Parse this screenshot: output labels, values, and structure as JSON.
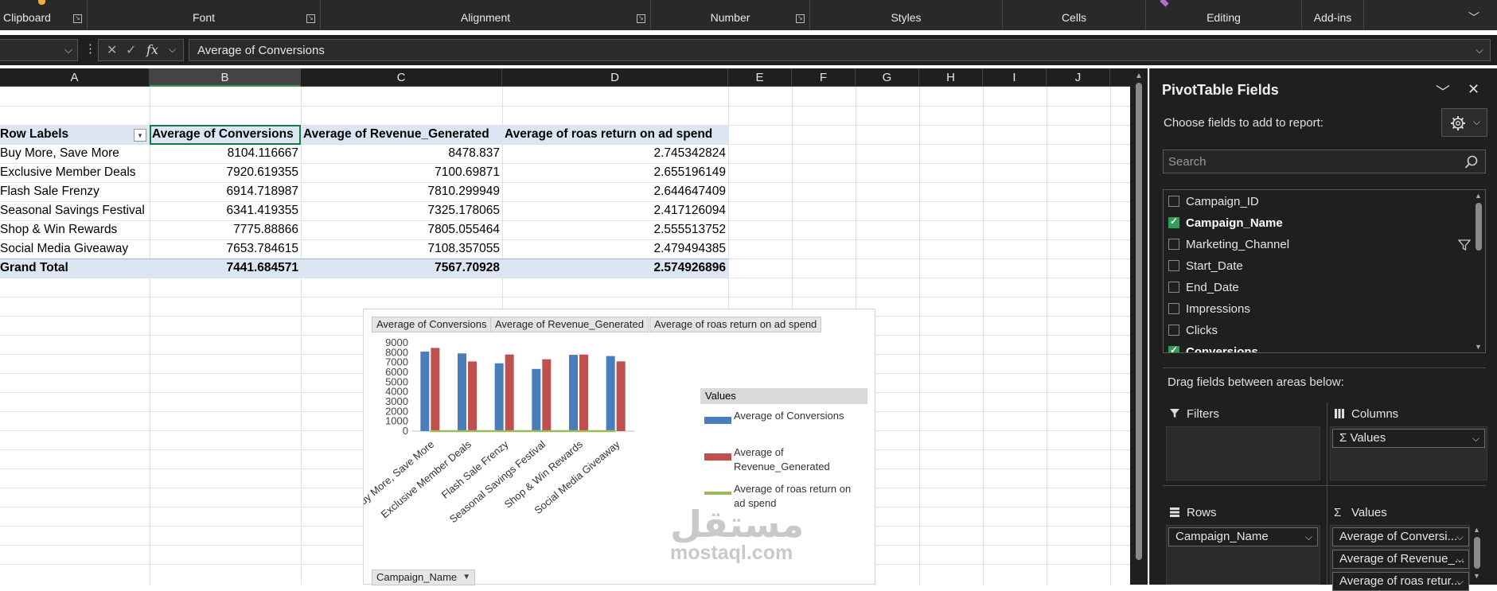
{
  "ribbon": {
    "groups": [
      {
        "name": "Clipboard"
      },
      {
        "name": "Font"
      },
      {
        "name": "Alignment"
      },
      {
        "name": "Number"
      },
      {
        "name": "Styles"
      },
      {
        "name": "Cells"
      },
      {
        "name": "Editing"
      },
      {
        "name": "Add-ins"
      }
    ]
  },
  "formula_bar": {
    "name_box": "",
    "cancel_icon": "✕",
    "enter_icon": "✓",
    "fx_label": "fx",
    "content": "Average of Conversions"
  },
  "columns": [
    "A",
    "B",
    "C",
    "D",
    "E",
    "F",
    "G",
    "H",
    "I",
    "J"
  ],
  "pivot": {
    "headers": [
      "Row Labels",
      "Average of Conversions",
      "Average of Revenue_Generated",
      "Average of roas return on ad spend"
    ],
    "rows": [
      {
        "label": "Buy More, Save More",
        "conv": "8104.116667",
        "rev": "8478.837",
        "roas": "2.745342824"
      },
      {
        "label": "Exclusive Member Deals",
        "conv": "7920.619355",
        "rev": "7100.69871",
        "roas": "2.655196149"
      },
      {
        "label": "Flash Sale Frenzy",
        "conv": "6914.718987",
        "rev": "7810.299949",
        "roas": "2.644647409"
      },
      {
        "label": "Seasonal Savings Festival",
        "conv": "6341.419355",
        "rev": "7325.178065",
        "roas": "2.417126094"
      },
      {
        "label": "Shop & Win Rewards",
        "conv": "7775.88866",
        "rev": "7805.055464",
        "roas": "2.555513752"
      },
      {
        "label": "Social Media Giveaway",
        "conv": "7653.784615",
        "rev": "7108.357055",
        "roas": "2.479494385"
      }
    ],
    "total": {
      "label": "Grand Total",
      "conv": "7441.684571",
      "rev": "7567.70928",
      "roas": "2.574926896"
    }
  },
  "chart_data": {
    "type": "bar",
    "field_buttons": [
      "Average of Conversions",
      "Average of Revenue_Generated",
      "Average of roas return on ad spend"
    ],
    "categories": [
      "Buy More, Save More",
      "Exclusive Member Deals",
      "Flash Sale Frenzy",
      "Seasonal Savings Festival",
      "Shop & Win Rewards",
      "Social Media Giveaway"
    ],
    "series": [
      {
        "name": "Average of Conversions",
        "values": [
          8104.116667,
          7920.619355,
          6914.718987,
          6341.419355,
          7775.88866,
          7653.784615
        ],
        "color": "#4a7ebb"
      },
      {
        "name": "Average of Revenue_Generated",
        "values": [
          8478.837,
          7100.69871,
          7810.299949,
          7325.178065,
          7805.055464,
          7108.357055
        ],
        "color": "#c0504d"
      },
      {
        "name": "Average of roas return on ad spend",
        "values": [
          2.745342824,
          2.655196149,
          2.644647409,
          2.417126094,
          2.555513752,
          2.479494385
        ],
        "color": "#9bbb59",
        "type": "line"
      }
    ],
    "legend_title": "Values",
    "legend_labels": [
      [
        "Average of Conversions"
      ],
      [
        "Average of",
        "Revenue_Generated"
      ],
      [
        "Average of roas return on",
        "ad spend"
      ]
    ],
    "ylim": [
      0,
      9000
    ],
    "yticks": [
      "9000",
      "8000",
      "7000",
      "6000",
      "5000",
      "4000",
      "3000",
      "2000",
      "1000",
      "0"
    ],
    "category_button": "Campaign_Name",
    "legend_position": "right"
  },
  "watermark": {
    "arabic": "مستقل",
    "latin": "mostaql.com"
  },
  "pivot_pane": {
    "title": "PivotTable Fields",
    "subtitle": "Choose fields to add to report:",
    "search_placeholder": "Search",
    "fields": [
      {
        "name": "Campaign_ID",
        "checked": false
      },
      {
        "name": "Campaign_Name",
        "checked": true
      },
      {
        "name": "Marketing_Channel",
        "checked": false
      },
      {
        "name": "Start_Date",
        "checked": false
      },
      {
        "name": "End_Date",
        "checked": false
      },
      {
        "name": "Impressions",
        "checked": false
      },
      {
        "name": "Clicks",
        "checked": false
      },
      {
        "name": "Conversions",
        "checked": true
      }
    ],
    "drag_hint": "Drag fields between areas below:",
    "areas": {
      "filters": "Filters",
      "columns": "Columns",
      "rows": "Rows",
      "values": "Values",
      "columns_items": [
        "Σ Values"
      ],
      "rows_items": [
        "Campaign_Name"
      ],
      "values_items": [
        "Average of Conversi...",
        "Average of Revenue_...",
        "Average of roas retur..."
      ]
    }
  }
}
